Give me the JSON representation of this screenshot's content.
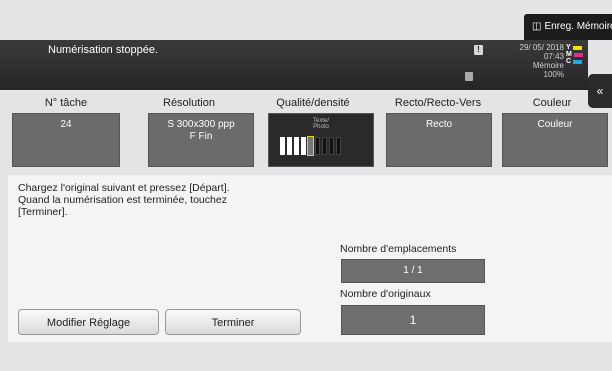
{
  "header": {
    "save_label": "Enreg. Mémoire",
    "status_text": "Numérisation stoppée.",
    "date": "29/ 05/ 2018",
    "time": "07:43",
    "memory_label": "Mémoire",
    "memory_value": "100%",
    "toner": [
      {
        "letter": "Y",
        "color": "#f5e000"
      },
      {
        "letter": "M",
        "color": "#e0308c"
      },
      {
        "letter": "C",
        "color": "#1fa8e0"
      }
    ]
  },
  "settings": {
    "job_number": {
      "label": "N° tâche",
      "value": "24"
    },
    "resolution": {
      "label": "Résolution",
      "value_line1": "S 300x300 ppp",
      "value_line2": "F Fin"
    },
    "quality": {
      "label": "Qualité/densité",
      "sub_line1": "Texte/",
      "sub_line2": "Photo",
      "density_level": 5,
      "density_steps": 9
    },
    "duplex": {
      "label": "Recto/Recto-Vers",
      "value": "Recto"
    },
    "color": {
      "label": "Couleur",
      "value": "Couleur"
    }
  },
  "message": "Chargez l'original suivant et pressez [Départ].\nQuand la numérisation est terminée, touchez\n[Terminer].",
  "locations": {
    "label": "Nombre d'emplacements",
    "value": "1 / 1"
  },
  "originals": {
    "label": "Nombre d'originaux",
    "value": "1"
  },
  "buttons": {
    "modify": "Modifier Réglage",
    "finish": "Terminer"
  },
  "colors": {
    "accent_dark": "#2a2a2a",
    "tile_gray": "#6b6b6d"
  }
}
